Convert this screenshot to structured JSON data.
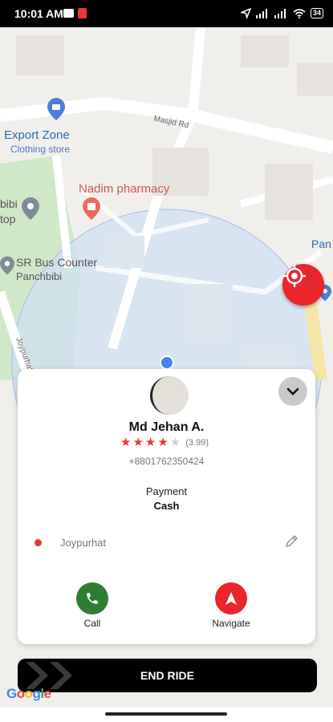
{
  "status_bar": {
    "time": "10:01 AM",
    "battery": "34"
  },
  "map": {
    "labels": {
      "export_zone": "Export Zone",
      "clothing_store": "Clothing store",
      "nadim_pharmacy": "Nadim pharmacy",
      "bibi": "bibi",
      "top": "top",
      "sr_bus_counter": "SR Bus Counter",
      "panchbibi": "Panchbibi",
      "masjid_rd": "Masjid Rd",
      "joypurhat_road": "Joypurhat",
      "pan": "Pan"
    },
    "logo": "Google"
  },
  "rider": {
    "name": "Md Jehan A.",
    "rating_display": "(3.99)",
    "rating_value": 3.99,
    "stars_filled": 4,
    "stars_total": 5,
    "phone": "+8801762350424"
  },
  "payment": {
    "label": "Payment",
    "method": "Cash"
  },
  "destination": {
    "text": "Joypurhat"
  },
  "actions": {
    "call_label": "Call",
    "navigate_label": "Navigate"
  },
  "end_ride": {
    "label": "END RIDE"
  },
  "colors": {
    "accent": "#e8262c",
    "call": "#2e7d32",
    "map_park": "#cfe8c8",
    "radius_circle": "#cfe0f3"
  },
  "icons": [
    "location-arrow-icon",
    "signal-icon",
    "wifi-icon",
    "battery-icon",
    "target-icon",
    "chevron-down-icon",
    "edit-pencil-icon",
    "phone-icon",
    "navigate-arrow-icon",
    "double-chevron-icon"
  ]
}
